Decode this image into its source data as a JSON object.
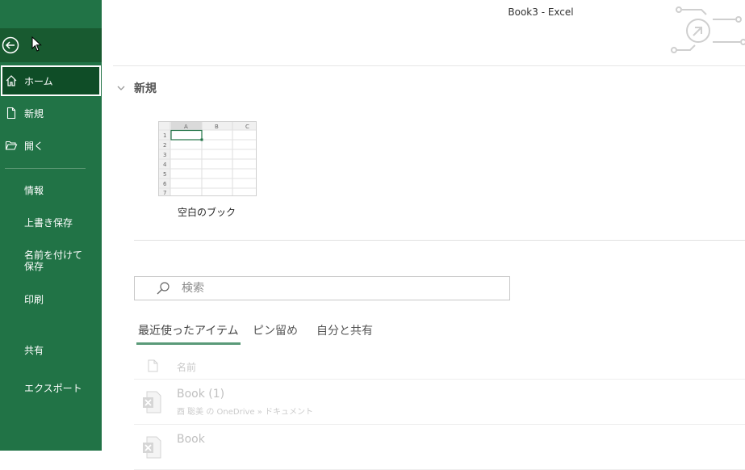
{
  "window": {
    "title": "Book3  -  Excel"
  },
  "sidebar": {
    "items": [
      {
        "label": "ホーム",
        "active": true
      },
      {
        "label": "新規"
      },
      {
        "label": "開く"
      }
    ],
    "text_items": [
      {
        "label": "情報"
      },
      {
        "label": "上書き保存"
      },
      {
        "label": "名前を付けて保存"
      },
      {
        "label": "印刷"
      },
      {
        "label": "共有"
      },
      {
        "label": "エクスポート"
      }
    ]
  },
  "new_section": {
    "heading": "新規",
    "template_label": "空白のブック",
    "thumb": {
      "cols": [
        "A",
        "B",
        "C"
      ],
      "rows": [
        "1",
        "2",
        "3",
        "4",
        "5",
        "6",
        "7"
      ]
    }
  },
  "search": {
    "placeholder": "検索"
  },
  "tabs": [
    {
      "label": "最近使ったアイテム",
      "active": true
    },
    {
      "label": "ピン留め"
    },
    {
      "label": "自分と共有"
    }
  ],
  "list": {
    "header_name": "名前",
    "files": [
      {
        "name": "Book (1)",
        "path": "酉 聡美 の OneDrive » ドキュメント"
      },
      {
        "name": "Book",
        "path": ""
      }
    ]
  },
  "colors": {
    "accent": "#217346",
    "active_nav": "#0f4d27",
    "tab_underline": "#5a9a78"
  }
}
